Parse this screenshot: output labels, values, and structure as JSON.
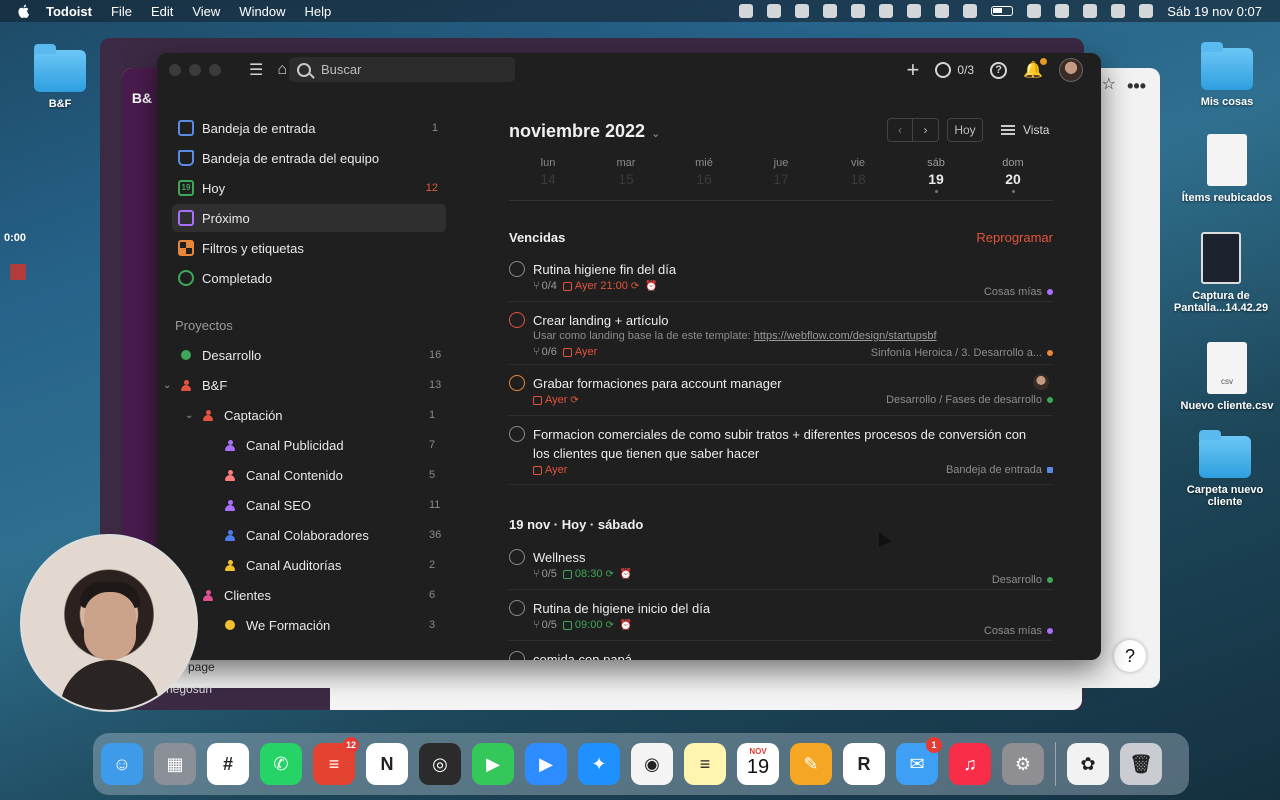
{
  "menubar": {
    "app": "Todoist",
    "items": [
      "File",
      "Edit",
      "View",
      "Window",
      "Help"
    ],
    "clock": "Sáb 19 nov 0:07"
  },
  "desktop": {
    "left_folder": "B&F",
    "icons": [
      {
        "label": "Mis cosas",
        "kind": "folder"
      },
      {
        "label": "Ítems reubicados",
        "kind": "doc"
      },
      {
        "label": "Captura de Pantalla...14.42.29",
        "kind": "screenshot"
      },
      {
        "label": "Nuevo cliente.csv",
        "kind": "csv",
        "ext": "csv"
      },
      {
        "label": "Carpeta nuevo cliente",
        "kind": "folder"
      }
    ],
    "recording_time": "0:00"
  },
  "background_window": {
    "label": "B&",
    "page_text": "page",
    "user_text": "hegosun",
    "help": "?"
  },
  "toolbar": {
    "search_placeholder": "Buscar",
    "karma": "0/3",
    "help": "?"
  },
  "sidebar": {
    "nav": [
      {
        "label": "Bandeja de entrada",
        "count": "1",
        "icon": "inbox-icon"
      },
      {
        "label": "Bandeja de entrada del equipo",
        "count": "",
        "icon": "team-inbox-icon"
      },
      {
        "label": "Hoy",
        "count": "12",
        "icon": "today-icon",
        "icon_text": "19"
      },
      {
        "label": "Próximo",
        "count": "",
        "icon": "upcoming-icon"
      },
      {
        "label": "Filtros y etiquetas",
        "count": "",
        "icon": "filters-icon"
      },
      {
        "label": "Completado",
        "count": "",
        "icon": "completed-icon"
      }
    ],
    "projects_title": "Proyectos",
    "projects": [
      {
        "label": "Desarrollo",
        "count": "16",
        "color": "#3ea75a",
        "kind": "dot"
      },
      {
        "label": "B&F",
        "count": "13",
        "color": "#e2543e",
        "kind": "person"
      },
      {
        "label": "Captación",
        "count": "1",
        "color": "#e2543e",
        "kind": "person"
      },
      {
        "label": "Canal Publicidad",
        "count": "7",
        "color": "#a970ff",
        "kind": "person"
      },
      {
        "label": "Canal Contenido",
        "count": "5",
        "color": "#ff7c7c",
        "kind": "person"
      },
      {
        "label": "Canal SEO",
        "count": "11",
        "color": "#a970ff",
        "kind": "person"
      },
      {
        "label": "Canal Colaboradores",
        "count": "36",
        "color": "#4d7cf0",
        "kind": "person"
      },
      {
        "label": "Canal Auditorías",
        "count": "2",
        "color": "#f2c12e",
        "kind": "person"
      },
      {
        "label": "Clientes",
        "count": "6",
        "color": "#e05194",
        "kind": "person"
      },
      {
        "label": "We Formación",
        "count": "3",
        "color": "#f2c12e",
        "kind": "dot"
      }
    ]
  },
  "calendar": {
    "month": "noviembre 2022",
    "today_button": "Hoy",
    "view_button": "Vista",
    "days": [
      {
        "name": "lun",
        "num": "14"
      },
      {
        "name": "mar",
        "num": "15"
      },
      {
        "name": "mié",
        "num": "16"
      },
      {
        "name": "jue",
        "num": "17"
      },
      {
        "name": "vie",
        "num": "18"
      },
      {
        "name": "sáb",
        "num": "19"
      },
      {
        "name": "dom",
        "num": "20"
      }
    ]
  },
  "overdue": {
    "title": "Vencidas",
    "action": "Reprogramar",
    "tasks": [
      {
        "title": "Rutina higiene fin del día",
        "sub": "0/4",
        "due": "Ayer 21:00",
        "project": "Cosas mías",
        "project_color": "#a970ff"
      },
      {
        "title": "Crear landing + artículo",
        "desc_prefix": "Usar como landing base la de este template: ",
        "desc_link": "https://webflow.com/design/startupsbf",
        "sub": "0/6",
        "due": "Ayer",
        "project": "Sinfonía Heroica / 3. Desarrollo a...",
        "project_color": "#e8873a"
      },
      {
        "title": "Grabar formaciones para account manager",
        "due": "Ayer",
        "project": "Desarrollo / Fases de desarrollo",
        "project_color": "#3ea75a"
      },
      {
        "title": "Formacion comerciales de como subir tratos + diferentes procesos de conversión con los clientes que tienen que saber hacer",
        "due": "Ayer",
        "project": "Bandeja de entrada",
        "project_color": "#5a8be3"
      }
    ]
  },
  "today": {
    "title": "19 nov · Hoy · sábado",
    "tasks": [
      {
        "title": "Wellness",
        "sub": "0/5",
        "due": "08:30",
        "project": "Desarrollo",
        "project_color": "#3ea75a"
      },
      {
        "title": "Rutina de higiene inicio del día",
        "sub": "0/5",
        "due": "09:00",
        "project": "Cosas mías",
        "project_color": "#a970ff"
      },
      {
        "title": "comida con papá"
      }
    ]
  },
  "dock": [
    {
      "name": "finder",
      "color": "#3d9be9",
      "glyph": "☺"
    },
    {
      "name": "launchpad",
      "color": "#8a8f98",
      "glyph": "▦"
    },
    {
      "name": "slack",
      "color": "#ffffff",
      "glyph": "#"
    },
    {
      "name": "whatsapp",
      "color": "#25d366",
      "glyph": "✆"
    },
    {
      "name": "todoist",
      "color": "#e44332",
      "glyph": "≡",
      "badge": "12"
    },
    {
      "name": "notion",
      "color": "#ffffff",
      "glyph": "N"
    },
    {
      "name": "obs",
      "color": "#2b2b2b",
      "glyph": "◎"
    },
    {
      "name": "facetime",
      "color": "#34c759",
      "glyph": "▶"
    },
    {
      "name": "zoom",
      "color": "#2d8cff",
      "glyph": "▶"
    },
    {
      "name": "safari",
      "color": "#1e90ff",
      "glyph": "✦"
    },
    {
      "name": "chrome",
      "color": "#f4f4f4",
      "glyph": "◉"
    },
    {
      "name": "notes",
      "color": "#fff4b0",
      "glyph": "≡"
    },
    {
      "name": "calendar",
      "kind": "cal",
      "month": "NOV",
      "day": "19"
    },
    {
      "name": "pages",
      "color": "#f5a623",
      "glyph": "✎"
    },
    {
      "name": "reeder",
      "color": "#ffffff",
      "glyph": "R"
    },
    {
      "name": "mail",
      "color": "#3ea0f5",
      "glyph": "✉",
      "badge": "1"
    },
    {
      "name": "music",
      "color": "#fa2d48",
      "glyph": "♫"
    },
    {
      "name": "settings",
      "color": "#8e8e93",
      "glyph": "⚙"
    },
    {
      "name": "sep"
    },
    {
      "name": "photos-app",
      "color": "#f2f2f2",
      "glyph": "✿"
    },
    {
      "name": "trash",
      "color": "#c9ccd1",
      "glyph": "🗑"
    }
  ]
}
